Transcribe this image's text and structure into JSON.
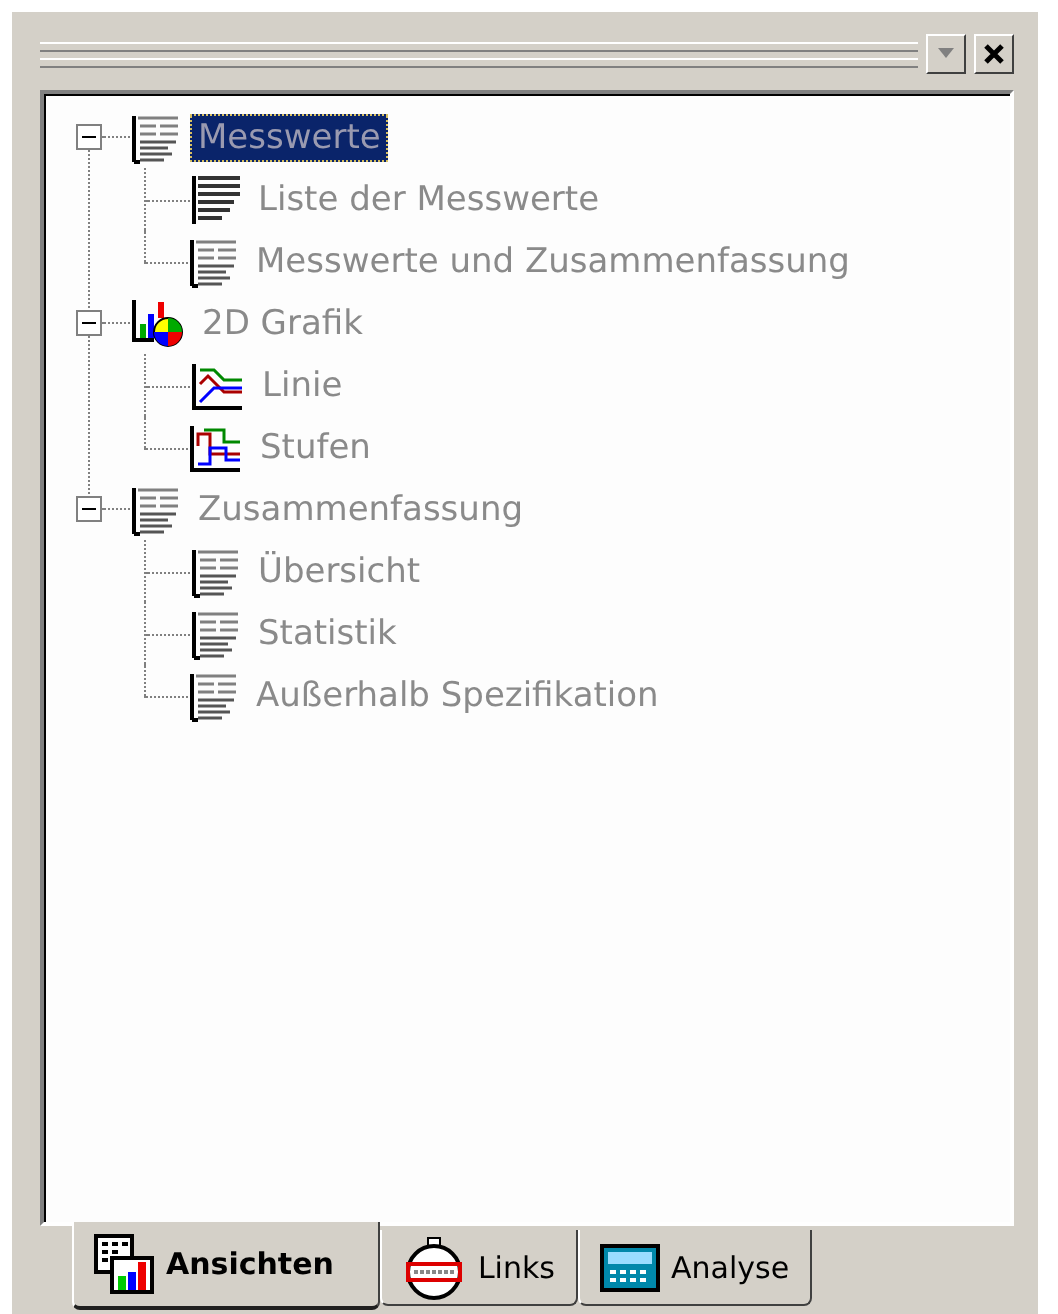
{
  "panel": {
    "buttons": [
      {
        "kind": "dropdown",
        "disabled": true
      },
      {
        "kind": "close",
        "disabled": false
      }
    ]
  },
  "tree": [
    {
      "label": "Messwerte",
      "kind": "report",
      "selected": true,
      "expanded": true,
      "children": [
        {
          "label": "Liste der Messwerte",
          "kind": "list",
          "selected": false
        },
        {
          "label": "Messwerte und Zusammenfassung",
          "kind": "report",
          "selected": false
        }
      ]
    },
    {
      "label": "2D Grafik",
      "kind": "chart",
      "selected": false,
      "expanded": true,
      "children": [
        {
          "label": "Linie",
          "kind": "line",
          "selected": false
        },
        {
          "label": "Stufen",
          "kind": "steps",
          "selected": false
        }
      ]
    },
    {
      "label": "Zusammenfassung",
      "kind": "report",
      "selected": false,
      "expanded": true,
      "children": [
        {
          "label": "Übersicht",
          "kind": "report",
          "selected": false
        },
        {
          "label": "Statistik",
          "kind": "report",
          "selected": false
        },
        {
          "label": "Außerhalb Spezifikation",
          "kind": "report",
          "selected": false
        }
      ]
    }
  ],
  "tabs": [
    {
      "label": "Ansichten",
      "kind": "views",
      "selected": true
    },
    {
      "label": "Links",
      "kind": "links",
      "selected": false
    },
    {
      "label": "Analyse",
      "kind": "analysis",
      "selected": false
    }
  ]
}
